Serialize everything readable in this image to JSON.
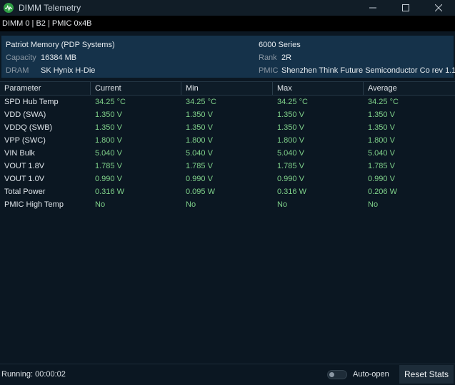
{
  "window": {
    "title": "DIMM Telemetry",
    "minimize_icon": "minimize-icon",
    "maximize_icon": "maximize-icon",
    "close_icon": "close-icon"
  },
  "subbar": {
    "text": "DIMM 0 | B2 | PMIC 0x4B"
  },
  "info": {
    "name": "Patriot Memory (PDP Systems)",
    "series": "6000 Series",
    "capacity_label": "Capacity",
    "capacity_value": "16384 MB",
    "rank_label": "Rank",
    "rank_value": "2R",
    "dram_label": "DRAM",
    "dram_value": "SK Hynix H-Die",
    "pmic_label": "PMIC",
    "pmic_value": "Shenzhen Think Future Semiconductor Co rev 1.1"
  },
  "table": {
    "headers": [
      "Parameter",
      "Current",
      "Min",
      "Max",
      "Average"
    ],
    "rows": [
      [
        "SPD Hub Temp",
        "34.25 °C",
        "34.25 °C",
        "34.25 °C",
        "34.25 °C"
      ],
      [
        "VDD (SWA)",
        "1.350 V",
        "1.350 V",
        "1.350 V",
        "1.350 V"
      ],
      [
        "VDDQ (SWB)",
        "1.350 V",
        "1.350 V",
        "1.350 V",
        "1.350 V"
      ],
      [
        "VPP (SWC)",
        "1.800 V",
        "1.800 V",
        "1.800 V",
        "1.800 V"
      ],
      [
        "VIN Bulk",
        "5.040 V",
        "5.040 V",
        "5.040 V",
        "5.040 V"
      ],
      [
        "VOUT 1.8V",
        "1.785 V",
        "1.785 V",
        "1.785 V",
        "1.785 V"
      ],
      [
        "VOUT 1.0V",
        "0.990 V",
        "0.990 V",
        "0.990 V",
        "0.990 V"
      ],
      [
        "Total Power",
        "0.316 W",
        "0.095 W",
        "0.316 W",
        "0.206 W"
      ],
      [
        "PMIC High Temp",
        "No",
        "No",
        "No",
        "No"
      ]
    ]
  },
  "status": {
    "running": "Running: 00:00:02",
    "auto_open_label": "Auto-open",
    "auto_open_on": false,
    "reset_label": "Reset Stats"
  },
  "colors": {
    "accent_green": "#7fd18a",
    "info_bg": "#15324a",
    "window_bg": "#0b1722"
  }
}
